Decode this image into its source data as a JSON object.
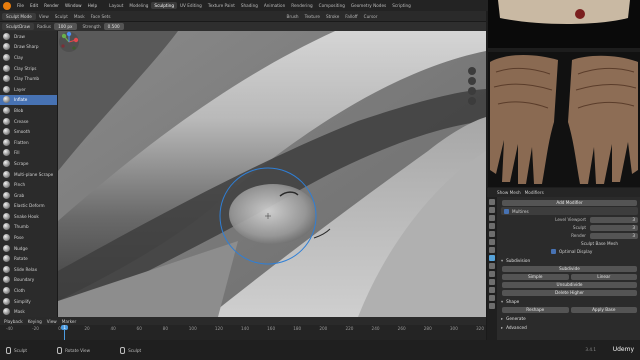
{
  "menubar": {
    "items": [
      "File",
      "Edit",
      "Render",
      "Window",
      "Help"
    ],
    "tabs": [
      "Layout",
      "Modeling",
      "Sculpting",
      "UV Editing",
      "Texture Paint",
      "Shading",
      "Animation",
      "Rendering",
      "Compositing",
      "Geometry Nodes",
      "Scripting"
    ],
    "active_tab": "Sculpting",
    "scene": "Scene",
    "view_layer": "ViewLayer"
  },
  "toolheader": {
    "mode": "Sculpt Mode",
    "menus": [
      "View",
      "Sculpt",
      "Mask",
      "Face Sets"
    ],
    "brush": "SculptDraw",
    "radius_label": "Radius",
    "radius_value": "100 px",
    "strength_label": "Strength",
    "strength_value": "0.500",
    "dropdowns": [
      "Brush",
      "Texture",
      "Stroke",
      "Falloff",
      "Cursor"
    ]
  },
  "brushes": [
    "Draw",
    "Draw Sharp",
    "Clay",
    "Clay Strips",
    "Clay Thumb",
    "Layer",
    "Inflate",
    "Blob",
    "Crease",
    "Smooth",
    "Flatten",
    "Fill",
    "Scrape",
    "Multi-plane Scrape",
    "Pinch",
    "Grab",
    "Elastic Deform",
    "Snake Hook",
    "Thumb",
    "Pose",
    "Nudge",
    "Rotate",
    "Slide Relax",
    "Boundary",
    "Cloth",
    "Simplify",
    "Mask"
  ],
  "active_brush_index": 6,
  "viewport": {
    "gizmo_axes": [
      "X",
      "Y",
      "Z"
    ]
  },
  "props": {
    "object_name": "Show Mesh",
    "modifier_tab": "Modifiers",
    "add_modifier": "Add Modifier",
    "modifier_name": "Multires",
    "rows": [
      {
        "label": "Level Viewport",
        "value": "3"
      },
      {
        "label": "Sculpt",
        "value": "3"
      },
      {
        "label": "Render",
        "value": "3"
      }
    ],
    "sculpt_base": "Sculpt Base Mesh",
    "optimal_display": "Optimal Display",
    "subdivision_section": "Subdivision",
    "subdivide": "Subdivide",
    "simple": "Simple",
    "linear": "Linear",
    "unsubdivide": "Unsubdivide",
    "delete_higher": "Delete Higher",
    "shape_section": "Shape",
    "reshape": "Reshape",
    "apply_base": "Apply Base",
    "generate_section": "Generate",
    "advanced_section": "Advanced"
  },
  "timeline": {
    "menus": [
      "Playback",
      "Keying",
      "View",
      "Marker"
    ],
    "ticks": [
      "-40",
      "-20",
      "0",
      "20",
      "40",
      "60",
      "80",
      "100",
      "120",
      "140",
      "160",
      "180",
      "200",
      "220",
      "240",
      "260",
      "280",
      "300",
      "320"
    ],
    "current_frame": "1"
  },
  "statusbar": {
    "items": [
      "Sculpt",
      "Rotate View",
      "Sculpt"
    ],
    "version": "3.4.1",
    "brand": "Udemy"
  },
  "colors": {
    "accent": "#4772b3",
    "gizmo_x": "#e5484d",
    "gizmo_y": "#6ab04c",
    "gizmo_z": "#4b8ef0",
    "brush_cursor": "#2f7fd6"
  }
}
